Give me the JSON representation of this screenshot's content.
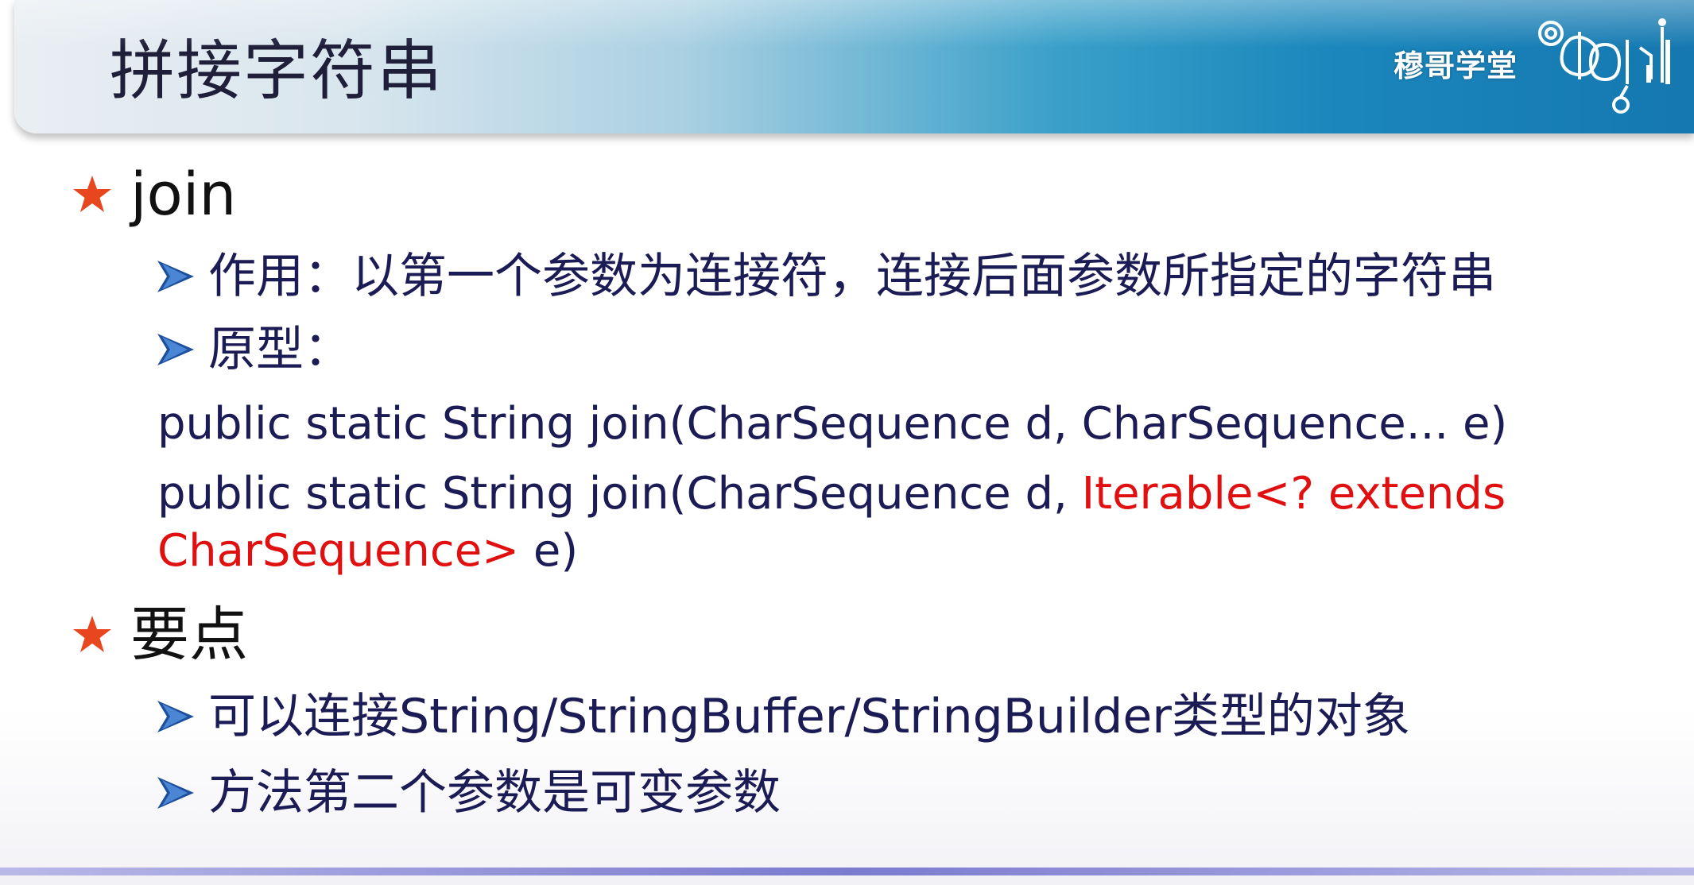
{
  "header": {
    "title": "拼接字符串",
    "brand": "穆哥学堂"
  },
  "sections": [
    {
      "heading": "join",
      "items": [
        "作用：以第一个参数为连接符，连接后面参数所指定的字符串",
        "原型："
      ],
      "code": {
        "line1": "public static String join(CharSequence d, CharSequence... e)",
        "line2_part1": "public static String join(CharSequence d, ",
        "line2_part2_red": "Iterable<? extends",
        "line3_part1_red": "CharSequence>",
        "line3_part2": " e)"
      }
    },
    {
      "heading": "要点",
      "items": [
        "可以连接String/StringBuffer/StringBuilder类型的对象",
        "方法第二个参数是可变参数"
      ]
    }
  ],
  "colors": {
    "star": "#e8461e",
    "arrow": "#1c4f9c",
    "text_dark": "#1b1b55",
    "code_red": "#e01010"
  }
}
